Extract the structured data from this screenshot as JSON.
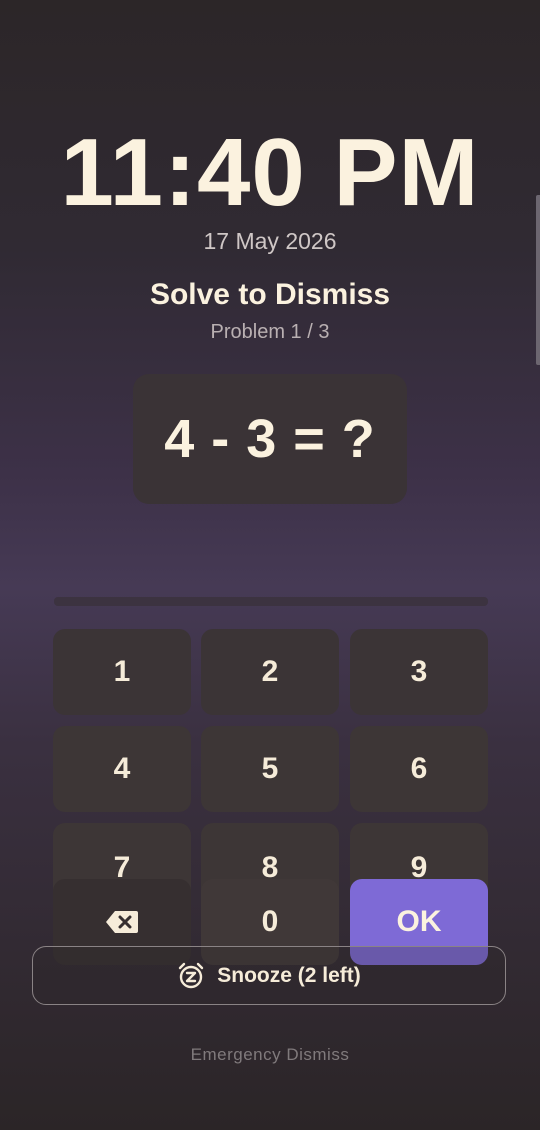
{
  "alarm": {
    "time": "11:40 PM",
    "date": "17 May 2026",
    "title": "Solve to Dismiss",
    "progress": "Problem 1 / 3",
    "problem": "4 - 3 = ?"
  },
  "keypad": {
    "keys": [
      "1",
      "2",
      "3",
      "4",
      "5",
      "6",
      "7",
      "8",
      "9",
      "0"
    ],
    "backspace_icon": "backspace-icon",
    "ok_label": "OK",
    "ok_color": "#7e6ad6"
  },
  "snooze": {
    "label": "Snooze (2 left)",
    "icon": "snooze-alarm-icon"
  },
  "emergency": {
    "label": "Emergency Dismiss"
  }
}
